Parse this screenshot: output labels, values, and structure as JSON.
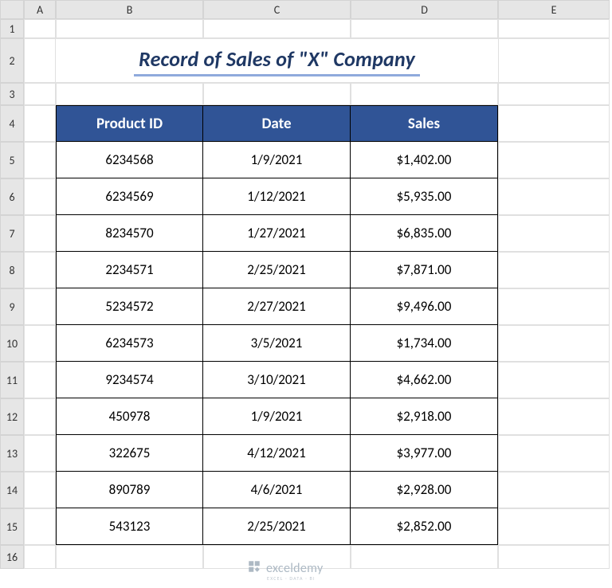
{
  "columns": [
    "A",
    "B",
    "C",
    "D",
    "E"
  ],
  "row_numbers": [
    "1",
    "2",
    "3",
    "4",
    "5",
    "6",
    "7",
    "8",
    "9",
    "10",
    "11",
    "12",
    "13",
    "14",
    "15",
    "16"
  ],
  "title": "Record of Sales of \"X\" Company",
  "table": {
    "headers": [
      "Product ID",
      "Date",
      "Sales"
    ],
    "rows": [
      {
        "product_id": "6234568",
        "date": "1/9/2021",
        "sales": "$1,402.00"
      },
      {
        "product_id": "6234569",
        "date": "1/12/2021",
        "sales": "$5,935.00"
      },
      {
        "product_id": "8234570",
        "date": "1/27/2021",
        "sales": "$6,835.00"
      },
      {
        "product_id": "2234571",
        "date": "2/25/2021",
        "sales": "$7,871.00"
      },
      {
        "product_id": "5234572",
        "date": "2/27/2021",
        "sales": "$9,496.00"
      },
      {
        "product_id": "6234573",
        "date": "3/5/2021",
        "sales": "$1,734.00"
      },
      {
        "product_id": "9234574",
        "date": "3/10/2021",
        "sales": "$4,662.00"
      },
      {
        "product_id": "450978",
        "date": "1/9/2021",
        "sales": "$2,918.00"
      },
      {
        "product_id": "322675",
        "date": "4/12/2021",
        "sales": "$3,977.00"
      },
      {
        "product_id": "890789",
        "date": "4/6/2021",
        "sales": "$2,928.00"
      },
      {
        "product_id": "543123",
        "date": "2/25/2021",
        "sales": "$2,852.00"
      }
    ]
  },
  "watermark": {
    "brand": "exceldemy",
    "tagline": "EXCEL · DATA · BI"
  }
}
